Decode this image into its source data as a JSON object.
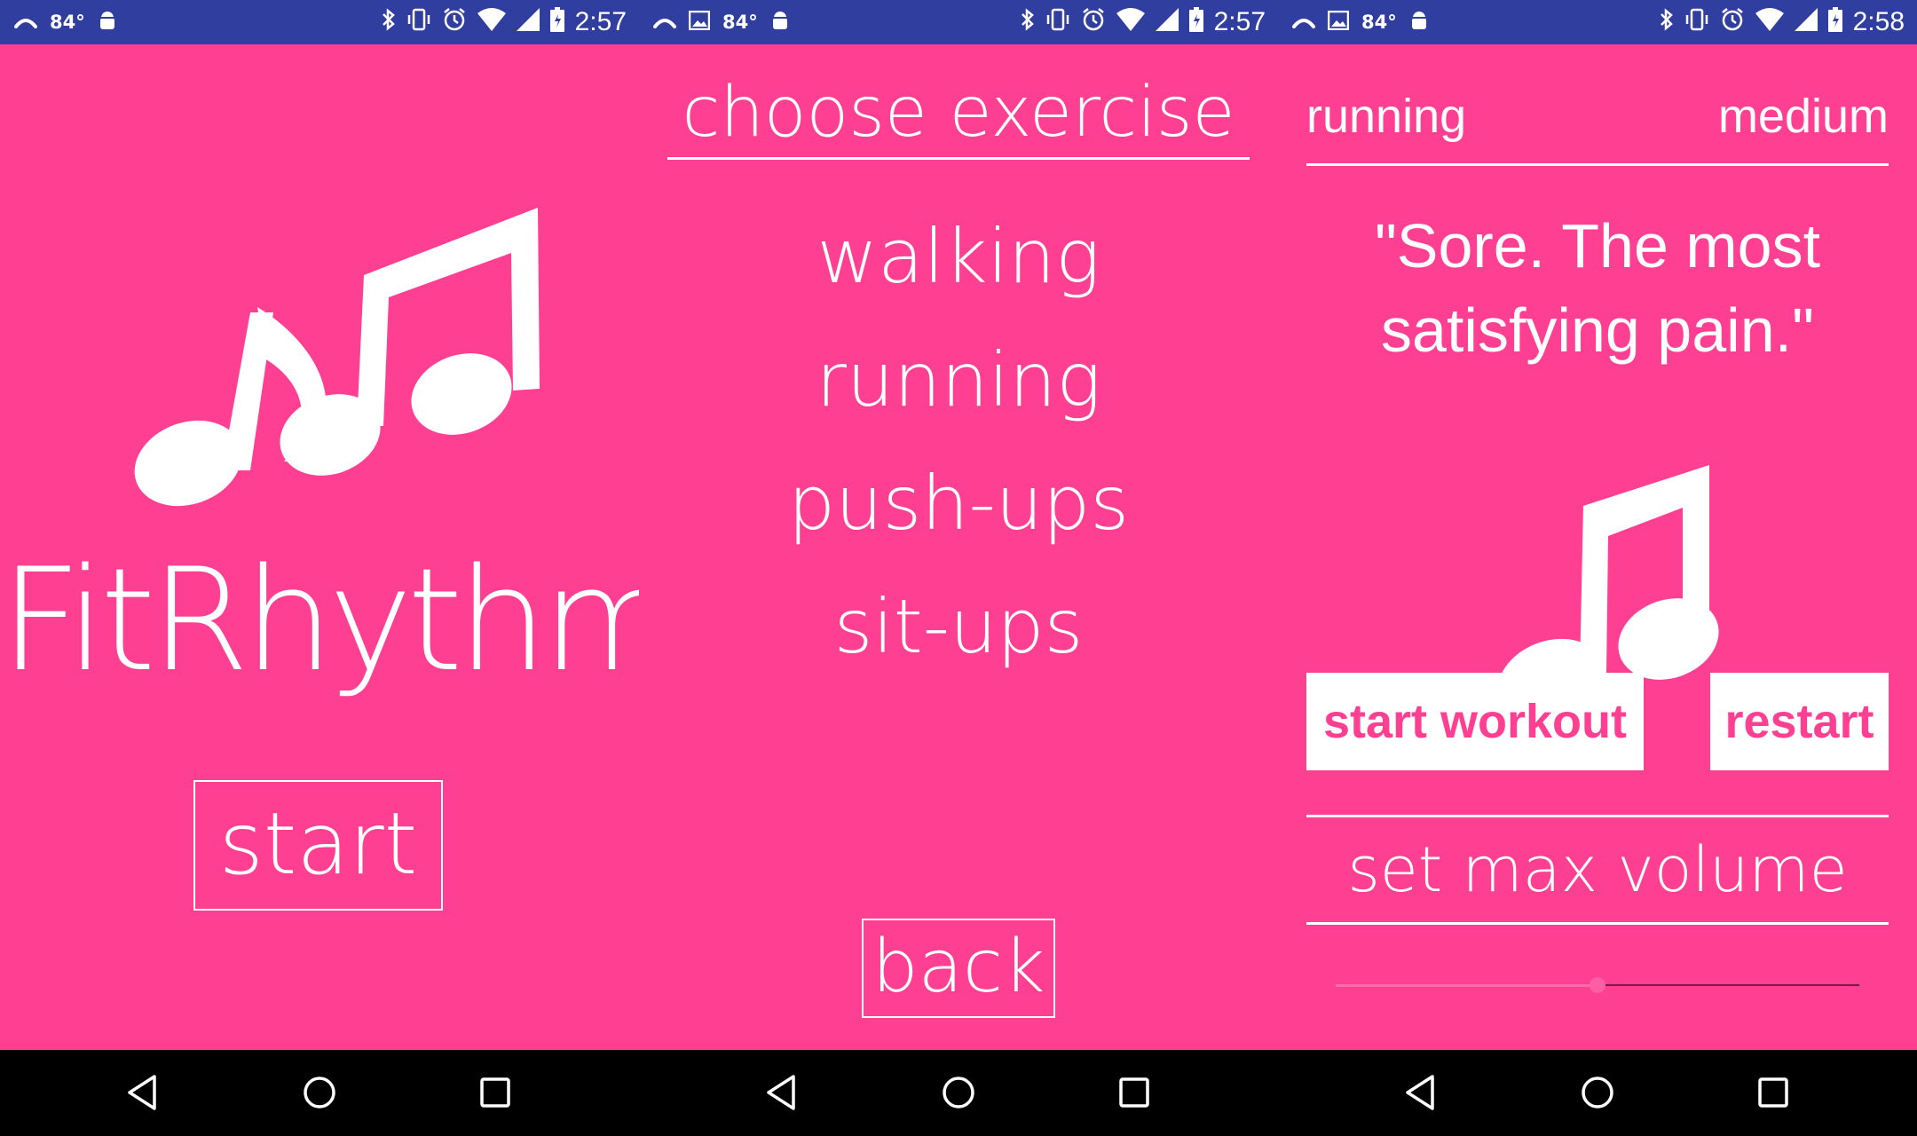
{
  "colors": {
    "accent": "#ff3f92",
    "status_bar": "#303f9f",
    "nav_bar": "#000000",
    "text": "#ffffff"
  },
  "screens": [
    {
      "status": {
        "temp": "84°",
        "time": "2:57"
      },
      "app_title": "FitRhythm",
      "start_label": "start",
      "icon": "music-notes-icon"
    },
    {
      "status": {
        "temp": "84°",
        "time": "2:57"
      },
      "title": "choose exercise",
      "exercises": [
        "walking",
        "running",
        "push-ups",
        "sit-ups"
      ],
      "back_label": "back"
    },
    {
      "status": {
        "temp": "84°",
        "time": "2:58"
      },
      "exercise": "running",
      "level": "medium",
      "quote": "\"Sore. The most satisfying pain.\"",
      "start_workout_label": "start workout",
      "restart_label": "restart",
      "volume_label": "set max volume",
      "volume_value": 0.5,
      "icon": "music-note-icon"
    }
  ]
}
